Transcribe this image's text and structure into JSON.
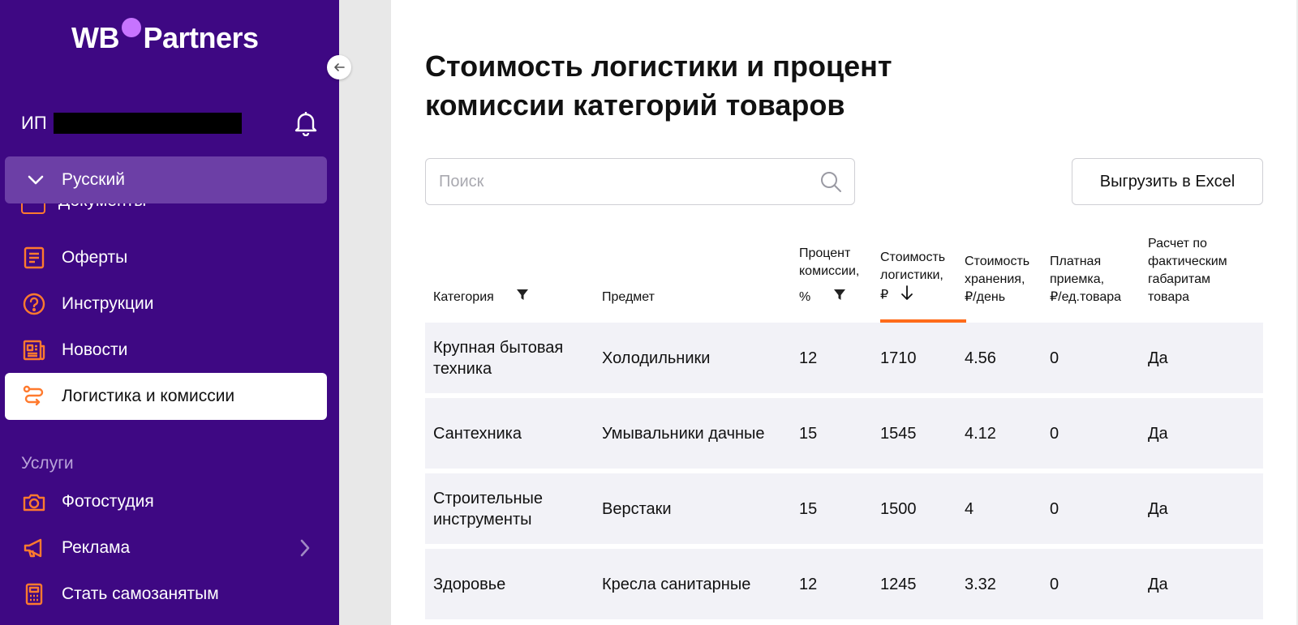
{
  "logo": {
    "wb": "WB",
    "partners": "Partners"
  },
  "user": {
    "prefix": "ИП"
  },
  "language": {
    "label": "Русский"
  },
  "hidden_item": {
    "label": "Документы"
  },
  "nav": [
    {
      "label": "Оферты",
      "icon": "document-icon"
    },
    {
      "label": "Инструкции",
      "icon": "question-icon"
    },
    {
      "label": "Новости",
      "icon": "newspaper-icon"
    },
    {
      "label": "Логистика и комиссии",
      "icon": "route-icon",
      "active": true
    }
  ],
  "services": {
    "title": "Услуги",
    "items": [
      {
        "label": "Фотостудия",
        "icon": "camera-icon"
      },
      {
        "label": "Реклама",
        "icon": "megaphone-icon",
        "has_arrow": true
      },
      {
        "label": "Стать самозанятым",
        "icon": "calculator-icon"
      }
    ]
  },
  "page": {
    "title": "Стоимость логистики и процент комиссии категорий товаров",
    "search_placeholder": "Поиск",
    "export_label": "Выгрузить в Excel"
  },
  "table": {
    "headers": {
      "category": "Категория",
      "subject": "Предмет",
      "commission_line1": "Процент",
      "commission_line2": "комиссии,",
      "commission_line3": "%",
      "logistics_line1": "Стоимость",
      "logistics_line2": "логистики,",
      "logistics_line3": "₽",
      "storage_line1": "Стоимость",
      "storage_line2": "хранения,",
      "storage_line3": "₽/день",
      "acceptance_line1": "Платная",
      "acceptance_line2": "приемка,",
      "acceptance_line3": "₽/ед.товара",
      "calc_line1": "Расчет по",
      "calc_line2": "фактическим",
      "calc_line3": "габаритам",
      "calc_line4": "товара"
    },
    "sort_column": "logistics",
    "sort_direction": "desc",
    "rows": [
      {
        "category": "Крупная бытовая техника",
        "subject": "Холодильники",
        "commission": "12",
        "logistics": "1710",
        "storage": "4.56",
        "acceptance": "0",
        "calc": "Да"
      },
      {
        "category": "Сантехника",
        "subject": "Умывальники дачные",
        "commission": "15",
        "logistics": "1545",
        "storage": "4.12",
        "acceptance": "0",
        "calc": "Да"
      },
      {
        "category": "Строительные инструменты",
        "subject": "Верстаки",
        "commission": "15",
        "logistics": "1500",
        "storage": "4",
        "acceptance": "0",
        "calc": "Да"
      },
      {
        "category": "Здоровье",
        "subject": "Кресла санитарные",
        "commission": "12",
        "logistics": "1245",
        "storage": "3.32",
        "acceptance": "0",
        "calc": "Да"
      }
    ]
  },
  "colors": {
    "sidebar": "#3e0883",
    "accent": "#ff6b1a",
    "icon": "#ff7a2e",
    "row_bg": "#f2f2f7"
  }
}
